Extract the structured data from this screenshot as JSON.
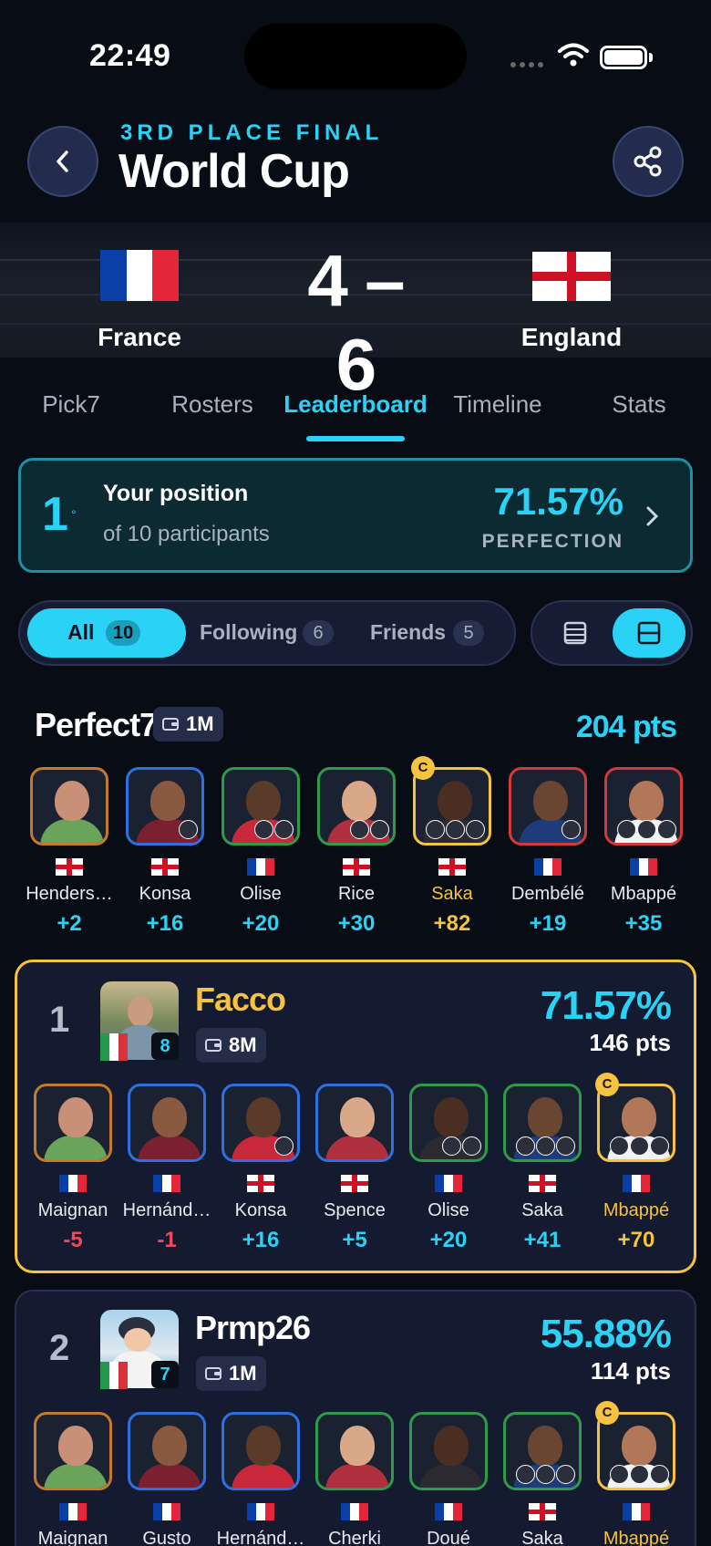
{
  "status_bar": {
    "time": "22:49"
  },
  "header": {
    "subtitle": "3RD PLACE FINAL",
    "title": "World Cup"
  },
  "match": {
    "home_team": "France",
    "away_team": "England",
    "score": "4 – 6"
  },
  "tabs": [
    {
      "label": "Pick7"
    },
    {
      "label": "Rosters"
    },
    {
      "label": "Leaderboard",
      "active": true
    },
    {
      "label": "Timeline"
    },
    {
      "label": "Stats"
    }
  ],
  "position_card": {
    "rank": "1",
    "degree": "°",
    "title": "Your position",
    "subtitle": "of 10 participants",
    "percent": "71.57%",
    "label": "PERFECTION"
  },
  "filters": [
    {
      "label": "All",
      "count": "10",
      "active": true
    },
    {
      "label": "Following",
      "count": "6"
    },
    {
      "label": "Friends",
      "count": "5"
    }
  ],
  "perfect7": {
    "title": "Perfect7",
    "wallet": "1M",
    "points": "204 pts",
    "players": [
      {
        "name": "Henders…",
        "pts": "+2",
        "flag": "en",
        "frame": "#c27a2c"
      },
      {
        "name": "Konsa",
        "pts": "+16",
        "flag": "en",
        "frame": "#2f6fe0"
      },
      {
        "name": "Olise",
        "pts": "+20",
        "flag": "fr",
        "frame": "#2f9a48"
      },
      {
        "name": "Rice",
        "pts": "+30",
        "flag": "en",
        "frame": "#2f9a48"
      },
      {
        "name": "Saka",
        "pts": "+82",
        "flag": "en",
        "frame": "#f5c340",
        "captain": true
      },
      {
        "name": "Dembélé",
        "pts": "+19",
        "flag": "fr",
        "frame": "#d23a3a"
      },
      {
        "name": "Mbappé",
        "pts": "+35",
        "flag": "fr",
        "frame": "#d23a3a"
      }
    ]
  },
  "entries": [
    {
      "rank": "1",
      "name": "Facco",
      "level": "8",
      "wallet": "8M",
      "percent": "71.57%",
      "points": "146 pts",
      "players": [
        {
          "name": "Maignan",
          "pts": "-5",
          "flag": "fr",
          "frame": "#c27a2c"
        },
        {
          "name": "Hernánd…",
          "pts": "-1",
          "flag": "fr",
          "frame": "#2f6fe0"
        },
        {
          "name": "Konsa",
          "pts": "+16",
          "flag": "en",
          "frame": "#2f6fe0"
        },
        {
          "name": "Spence",
          "pts": "+5",
          "flag": "en",
          "frame": "#2f6fe0"
        },
        {
          "name": "Olise",
          "pts": "+20",
          "flag": "fr",
          "frame": "#2f9a48"
        },
        {
          "name": "Saka",
          "pts": "+41",
          "flag": "en",
          "frame": "#2f9a48"
        },
        {
          "name": "Mbappé",
          "pts": "+70",
          "flag": "fr",
          "frame": "#f5c340",
          "captain": true
        }
      ]
    },
    {
      "rank": "2",
      "name": "Prmp26",
      "level": "7",
      "wallet": "1M",
      "percent": "55.88%",
      "points": "114 pts",
      "players": [
        {
          "name": "Maignan",
          "flag": "fr",
          "frame": "#c27a2c"
        },
        {
          "name": "Gusto",
          "flag": "fr",
          "frame": "#2f6fe0"
        },
        {
          "name": "Hernánd…",
          "flag": "fr",
          "frame": "#2f6fe0"
        },
        {
          "name": "Cherki",
          "flag": "fr",
          "frame": "#2f9a48"
        },
        {
          "name": "Doué",
          "flag": "fr",
          "frame": "#2f9a48"
        },
        {
          "name": "Saka",
          "flag": "en",
          "frame": "#2f9a48"
        },
        {
          "name": "Mbappé",
          "flag": "fr",
          "frame": "#f5c340",
          "captain": true
        }
      ]
    }
  ],
  "colors": {
    "accent": "#2ad3f5",
    "captain": "#f5c340",
    "negative": "#ef4a5a",
    "background": "#080c14"
  },
  "icons": {
    "back": "chevron-left-icon",
    "share": "share-icon",
    "wallet": "wallet-icon",
    "list": "list-view-icon",
    "card": "card-view-icon"
  }
}
